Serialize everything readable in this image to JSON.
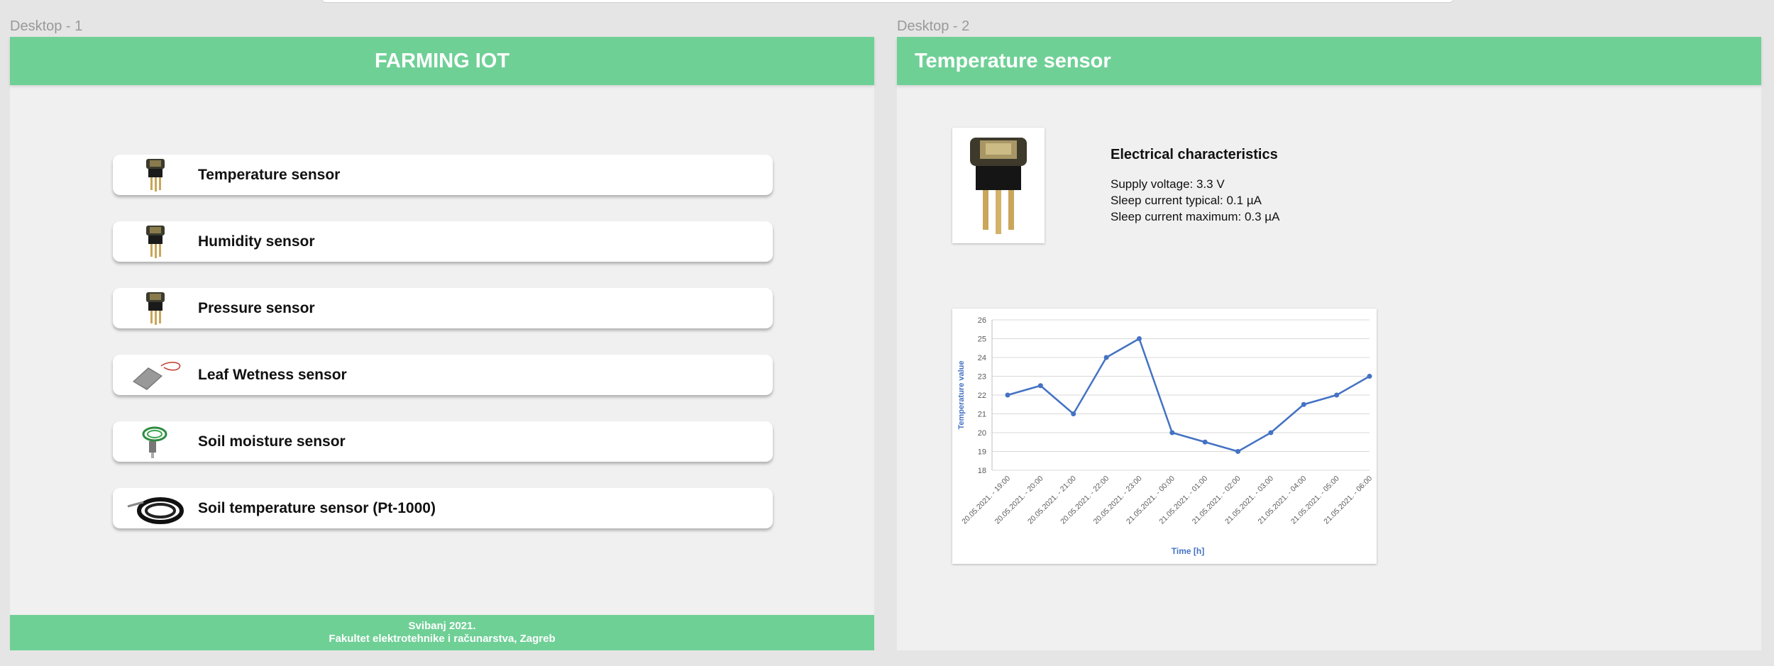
{
  "frames": {
    "desktop1_label": "Desktop - 1",
    "desktop2_label": "Desktop - 2"
  },
  "home": {
    "title": "FARMING IOT",
    "sensors": [
      {
        "label": "Temperature sensor",
        "icon": "sensor-chip-icon"
      },
      {
        "label": "Humidity sensor",
        "icon": "sensor-chip-icon"
      },
      {
        "label": "Pressure sensor",
        "icon": "sensor-chip-icon"
      },
      {
        "label": "Leaf Wetness sensor",
        "icon": "leaf-wetness-icon"
      },
      {
        "label": "Soil moisture sensor",
        "icon": "soil-moisture-probe-icon"
      },
      {
        "label": "Soil temperature sensor (Pt-1000)",
        "icon": "soil-temperature-probe-icon"
      }
    ],
    "footer": {
      "line1": "Svibanj 2021.",
      "line2": "Fakultet elektrotehnike i računarstva, Zagreb"
    }
  },
  "detail": {
    "title": "Temperature sensor",
    "photo_icon": "sensor-chip-icon",
    "electrical": {
      "title": "Electrical characteristics",
      "lines": [
        "Supply voltage: 3.3 V",
        "Sleep current typical: 0.1 µA",
        "Sleep current maximum: 0.3 µA"
      ]
    }
  },
  "colors": {
    "header_green": "#6fd096",
    "line_blue": "#4472c4"
  },
  "chart_data": {
    "type": "line",
    "title": "",
    "xlabel": "Time [h]",
    "ylabel": "Temperature value",
    "ylim": [
      18,
      26
    ],
    "yticks": [
      18,
      19,
      20,
      21,
      22,
      23,
      24,
      25,
      26
    ],
    "grid": true,
    "categories": [
      "20.05.2021. - 19:00",
      "20.05.2021. - 20:00",
      "20.05.2021. - 21:00",
      "20.05.2021. - 22:00",
      "20.05.2021. - 23:00",
      "21.05.2021. - 00:00",
      "21.05.2021. - 01:00",
      "21.05.2021. - 02:00",
      "21.05.2021. - 03:00",
      "21.05.2021. - 04:00",
      "21.05.2021. - 05:00",
      "21.05.2021. - 06:00"
    ],
    "values": [
      22,
      22.5,
      21,
      24,
      25,
      20,
      19.5,
      19,
      20,
      21.5,
      22,
      23
    ]
  }
}
